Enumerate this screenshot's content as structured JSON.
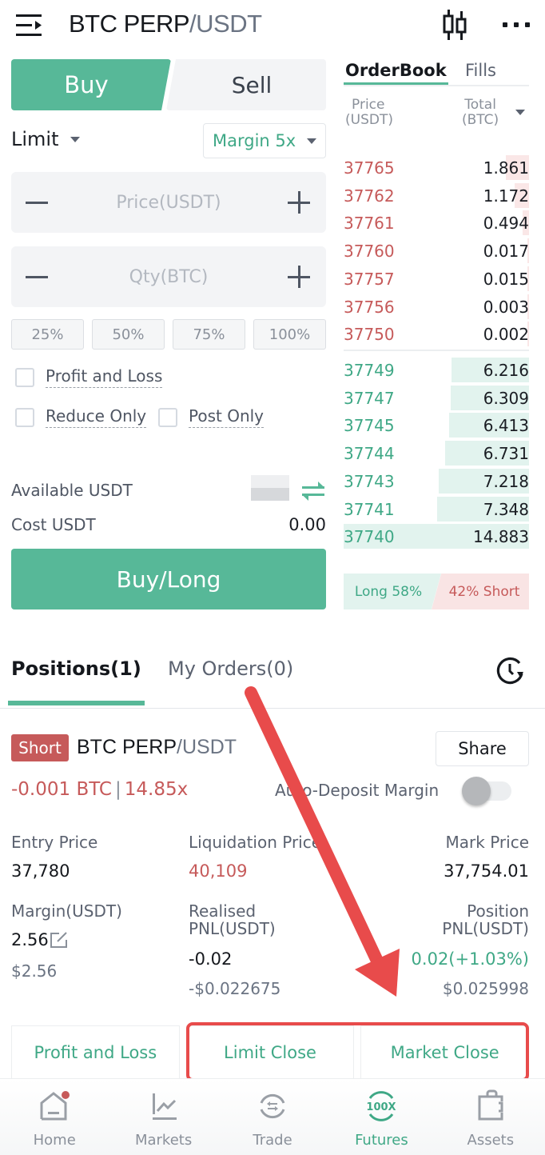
{
  "header": {
    "symbol_base": "BTC PERP",
    "symbol_quote": "/USDT",
    "icons": [
      "menu-icon",
      "candlestick-chart-icon",
      "more-icon"
    ]
  },
  "order_form": {
    "side_tabs": {
      "buy": "Buy",
      "sell": "Sell",
      "selected": "Buy"
    },
    "order_type": "Limit",
    "margin_select": "Margin 5x",
    "price_input": {
      "placeholder": "Price(USDT)",
      "value": ""
    },
    "qty_input": {
      "placeholder": "Qty(BTC)",
      "value": ""
    },
    "percent_buttons": [
      "25%",
      "50%",
      "75%",
      "100%"
    ],
    "checkboxes": {
      "profit_and_loss": {
        "label": "Profit and Loss",
        "checked": false
      },
      "reduce_only": {
        "label": "Reduce Only",
        "checked": false
      },
      "post_only": {
        "label": "Post Only",
        "checked": false
      }
    },
    "available_label": "Available USDT",
    "cost_label": "Cost USDT",
    "cost_value": "0.00",
    "submit_label": "Buy/Long"
  },
  "orderbook": {
    "tabs": {
      "orderbook": "OrderBook",
      "fills": "Fills",
      "selected": "OrderBook"
    },
    "price_header_1": "Price",
    "price_header_2": "(USDT)",
    "total_header_1": "Total",
    "total_header_2": "(BTC)",
    "max_total": 14.883,
    "asks": [
      {
        "price": "37765",
        "total": "1.861"
      },
      {
        "price": "37762",
        "total": "1.172"
      },
      {
        "price": "37761",
        "total": "0.494"
      },
      {
        "price": "37760",
        "total": "0.017"
      },
      {
        "price": "37757",
        "total": "0.015"
      },
      {
        "price": "37756",
        "total": "0.003"
      },
      {
        "price": "37750",
        "total": "0.002"
      }
    ],
    "bids": [
      {
        "price": "37749",
        "total": "6.216"
      },
      {
        "price": "37747",
        "total": "6.309"
      },
      {
        "price": "37745",
        "total": "6.413"
      },
      {
        "price": "37744",
        "total": "6.731"
      },
      {
        "price": "37743",
        "total": "7.218"
      },
      {
        "price": "37741",
        "total": "7.348"
      },
      {
        "price": "37740",
        "total": "14.883"
      }
    ],
    "long_label": "Long 58%",
    "short_label": "42% Short",
    "long_pct": 58,
    "short_pct": 42
  },
  "positions": {
    "tabs": {
      "positions": "Positions(1)",
      "orders": "My Orders(0)",
      "selected": "Positions(1)"
    },
    "card": {
      "side_badge": "Short",
      "symbol_base": "BTC PERP",
      "symbol_quote": "/USDT",
      "share_label": "Share",
      "size": "-0.001 BTC",
      "separator": "|",
      "leverage": "14.85x",
      "auto_deposit_label": "Auto-Deposit Margin",
      "auto_deposit_on": false,
      "entry_price_label": "Entry Price",
      "entry_price": "37,780",
      "liq_price_label": "Liquidation Price",
      "liq_price": "40,109",
      "mark_price_label": "Mark Price",
      "mark_price": "37,754.01",
      "margin_label": "Margin(USDT)",
      "margin_value": "2.56",
      "margin_usd": "$2.56",
      "realised_label_1": "Realised",
      "realised_label_2": "PNL(USDT)",
      "realised_value": "-0.02",
      "realised_usd": "-$0.022675",
      "position_label_1": "Position",
      "position_label_2": "PNL(USDT)",
      "position_value": "0.02(+1.03%)",
      "position_usd": "$0.025998"
    },
    "actions": [
      "Profit and Loss",
      "Limit Close",
      "Market Close"
    ]
  },
  "bottom_nav": {
    "items": [
      {
        "label": "Home",
        "icon": "home-icon",
        "badge": true
      },
      {
        "label": "Markets",
        "icon": "markets-chart-icon"
      },
      {
        "label": "Trade",
        "icon": "trade-exchange-icon"
      },
      {
        "label": "Futures",
        "icon": "futures-100x-icon",
        "active": true
      },
      {
        "label": "Assets",
        "icon": "wallet-icon"
      }
    ]
  },
  "colors": {
    "accent_green": "#57b898",
    "text_green": "#3fa886",
    "red": "#c65a5a",
    "annotation_red": "#e84b4b"
  }
}
